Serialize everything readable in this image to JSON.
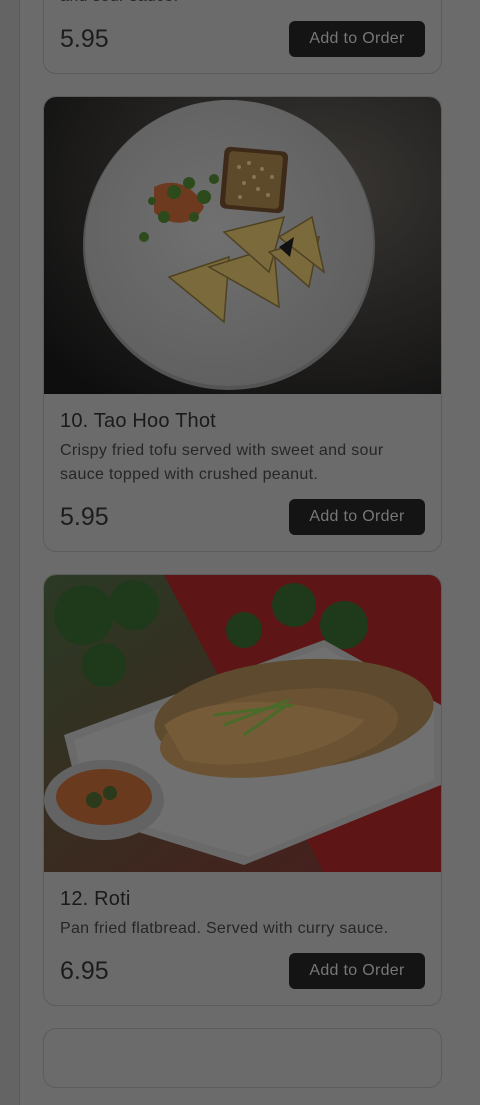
{
  "menu": {
    "items": [
      {
        "desc": "Crispy fried vegetable rolls served with sweet and sour sauce.",
        "price": "5.95",
        "button_label": "Add to Order"
      },
      {
        "title": "10. Tao Hoo Thot",
        "desc": "Crispy fried tofu served with sweet and sour sauce topped with crushed peanut.",
        "price": "5.95",
        "button_label": "Add to Order",
        "image": "fried-tofu-photo"
      },
      {
        "title": "12. Roti",
        "desc": "Pan fried flatbread. Served with curry sauce.",
        "price": "6.95",
        "button_label": "Add to Order",
        "image": "roti-photo"
      }
    ]
  },
  "colors": {
    "overlay": "#6b6b6b",
    "button_bg": "#141414",
    "button_text": "#777777"
  }
}
